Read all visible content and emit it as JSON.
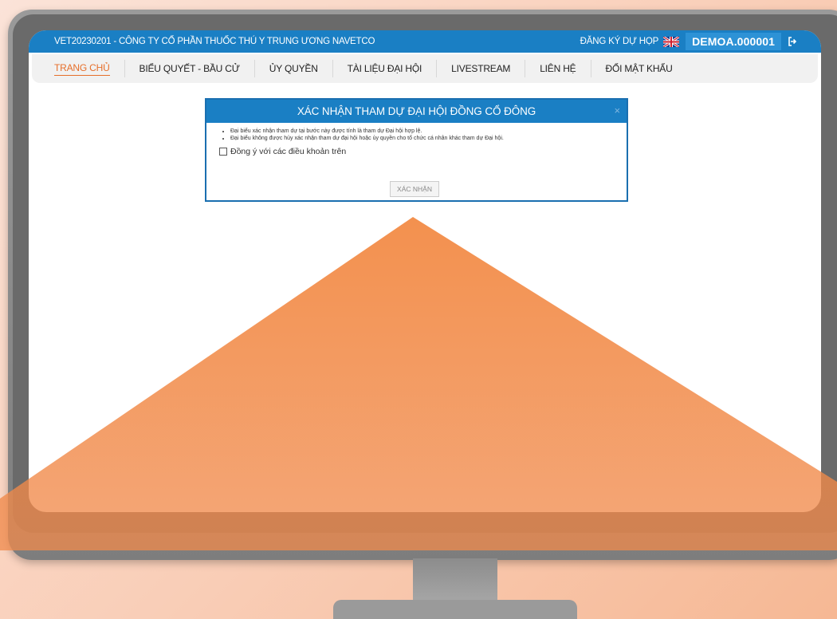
{
  "header": {
    "title": "VET20230201 - CÔNG TY CỔ PHẦN THUỐC THÚ Y TRUNG ƯƠNG NAVETCO",
    "register_label": "ĐĂNG KÝ DỰ HỌP",
    "account_id": "DEMOA.000001",
    "flag_icon": "uk-flag-icon",
    "logout_icon": "logout-icon"
  },
  "nav": {
    "items": [
      {
        "label": "TRANG CHỦ"
      },
      {
        "label": "BIỂU QUYẾT - BẦU CỬ"
      },
      {
        "label": "ỦY QUYỀN"
      },
      {
        "label": "TÀI LIỆU ĐẠI HỘI"
      },
      {
        "label": "LIVESTREAM"
      },
      {
        "label": "LIÊN HỆ"
      },
      {
        "label": "ĐỔI MẬT KHẨU"
      }
    ],
    "active_index": 0
  },
  "modal": {
    "title": "XÁC NHẬN THAM DỰ ĐẠI HỘI ĐỒNG CỔ ĐÔNG",
    "close_symbol": "×",
    "notes": [
      "Đại biểu xác nhận tham dự tại bước này được tính là tham dự Đại hội hợp lệ.",
      "Đại biểu không được hủy xác nhận tham dự đại hội hoặc ủy quyền cho tổ chức cá nhân khác tham dự Đại hội."
    ],
    "agree_label": "Đồng ý với các điều khoản trên",
    "agree_checked": false,
    "confirm_label": "XÁC NHẬN"
  },
  "colors": {
    "primary": "#1a7fc4",
    "accent": "#e66f2b",
    "decoration": "#f2873f"
  }
}
